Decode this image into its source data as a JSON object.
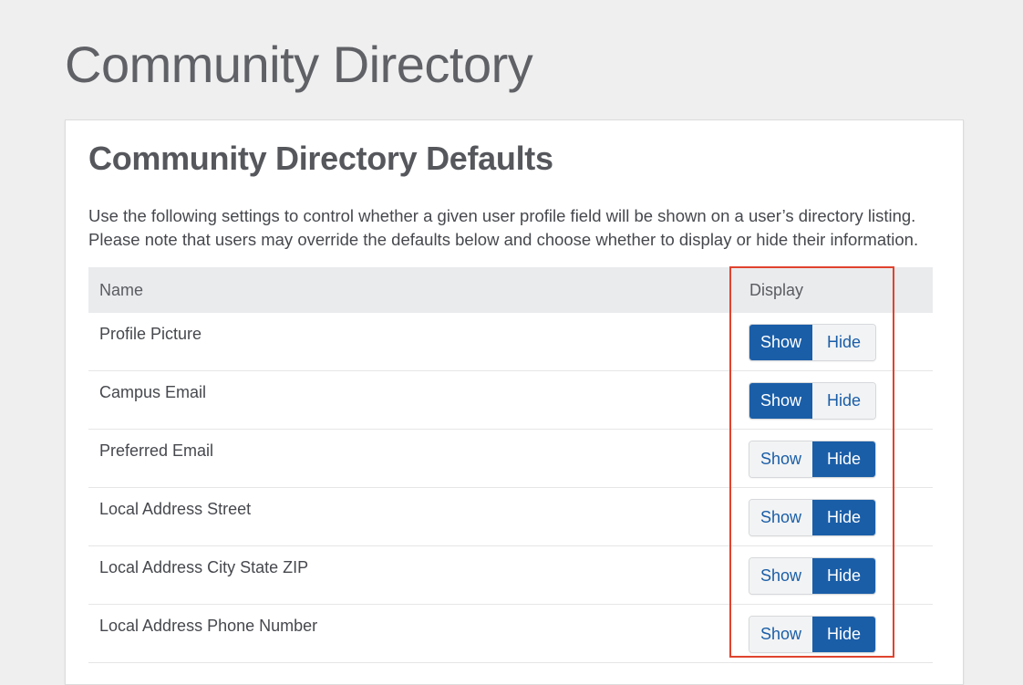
{
  "page": {
    "title": "Community Directory"
  },
  "card": {
    "title": "Community Directory Defaults",
    "description_lines": [
      "Use the following settings to control whether a given user profile field will be shown on a user’s directory listing.",
      "Please note that users may override the defaults below and choose whether to display or hide their information."
    ]
  },
  "table": {
    "headers": [
      "Name",
      "Display"
    ],
    "rows": [
      {
        "name": "Profile Picture",
        "selected": "Show"
      },
      {
        "name": "Campus Email",
        "selected": "Show"
      },
      {
        "name": "Preferred Email",
        "selected": "Hide"
      },
      {
        "name": "Local Address Street",
        "selected": "Hide"
      },
      {
        "name": "Local Address City State ZIP",
        "selected": "Hide"
      },
      {
        "name": "Local Address Phone Number",
        "selected": "Hide"
      }
    ],
    "options": [
      "Show",
      "Hide"
    ]
  },
  "colors": {
    "accent": "#1a5ea8",
    "highlight": "#e0432e",
    "background": "#efefef"
  }
}
